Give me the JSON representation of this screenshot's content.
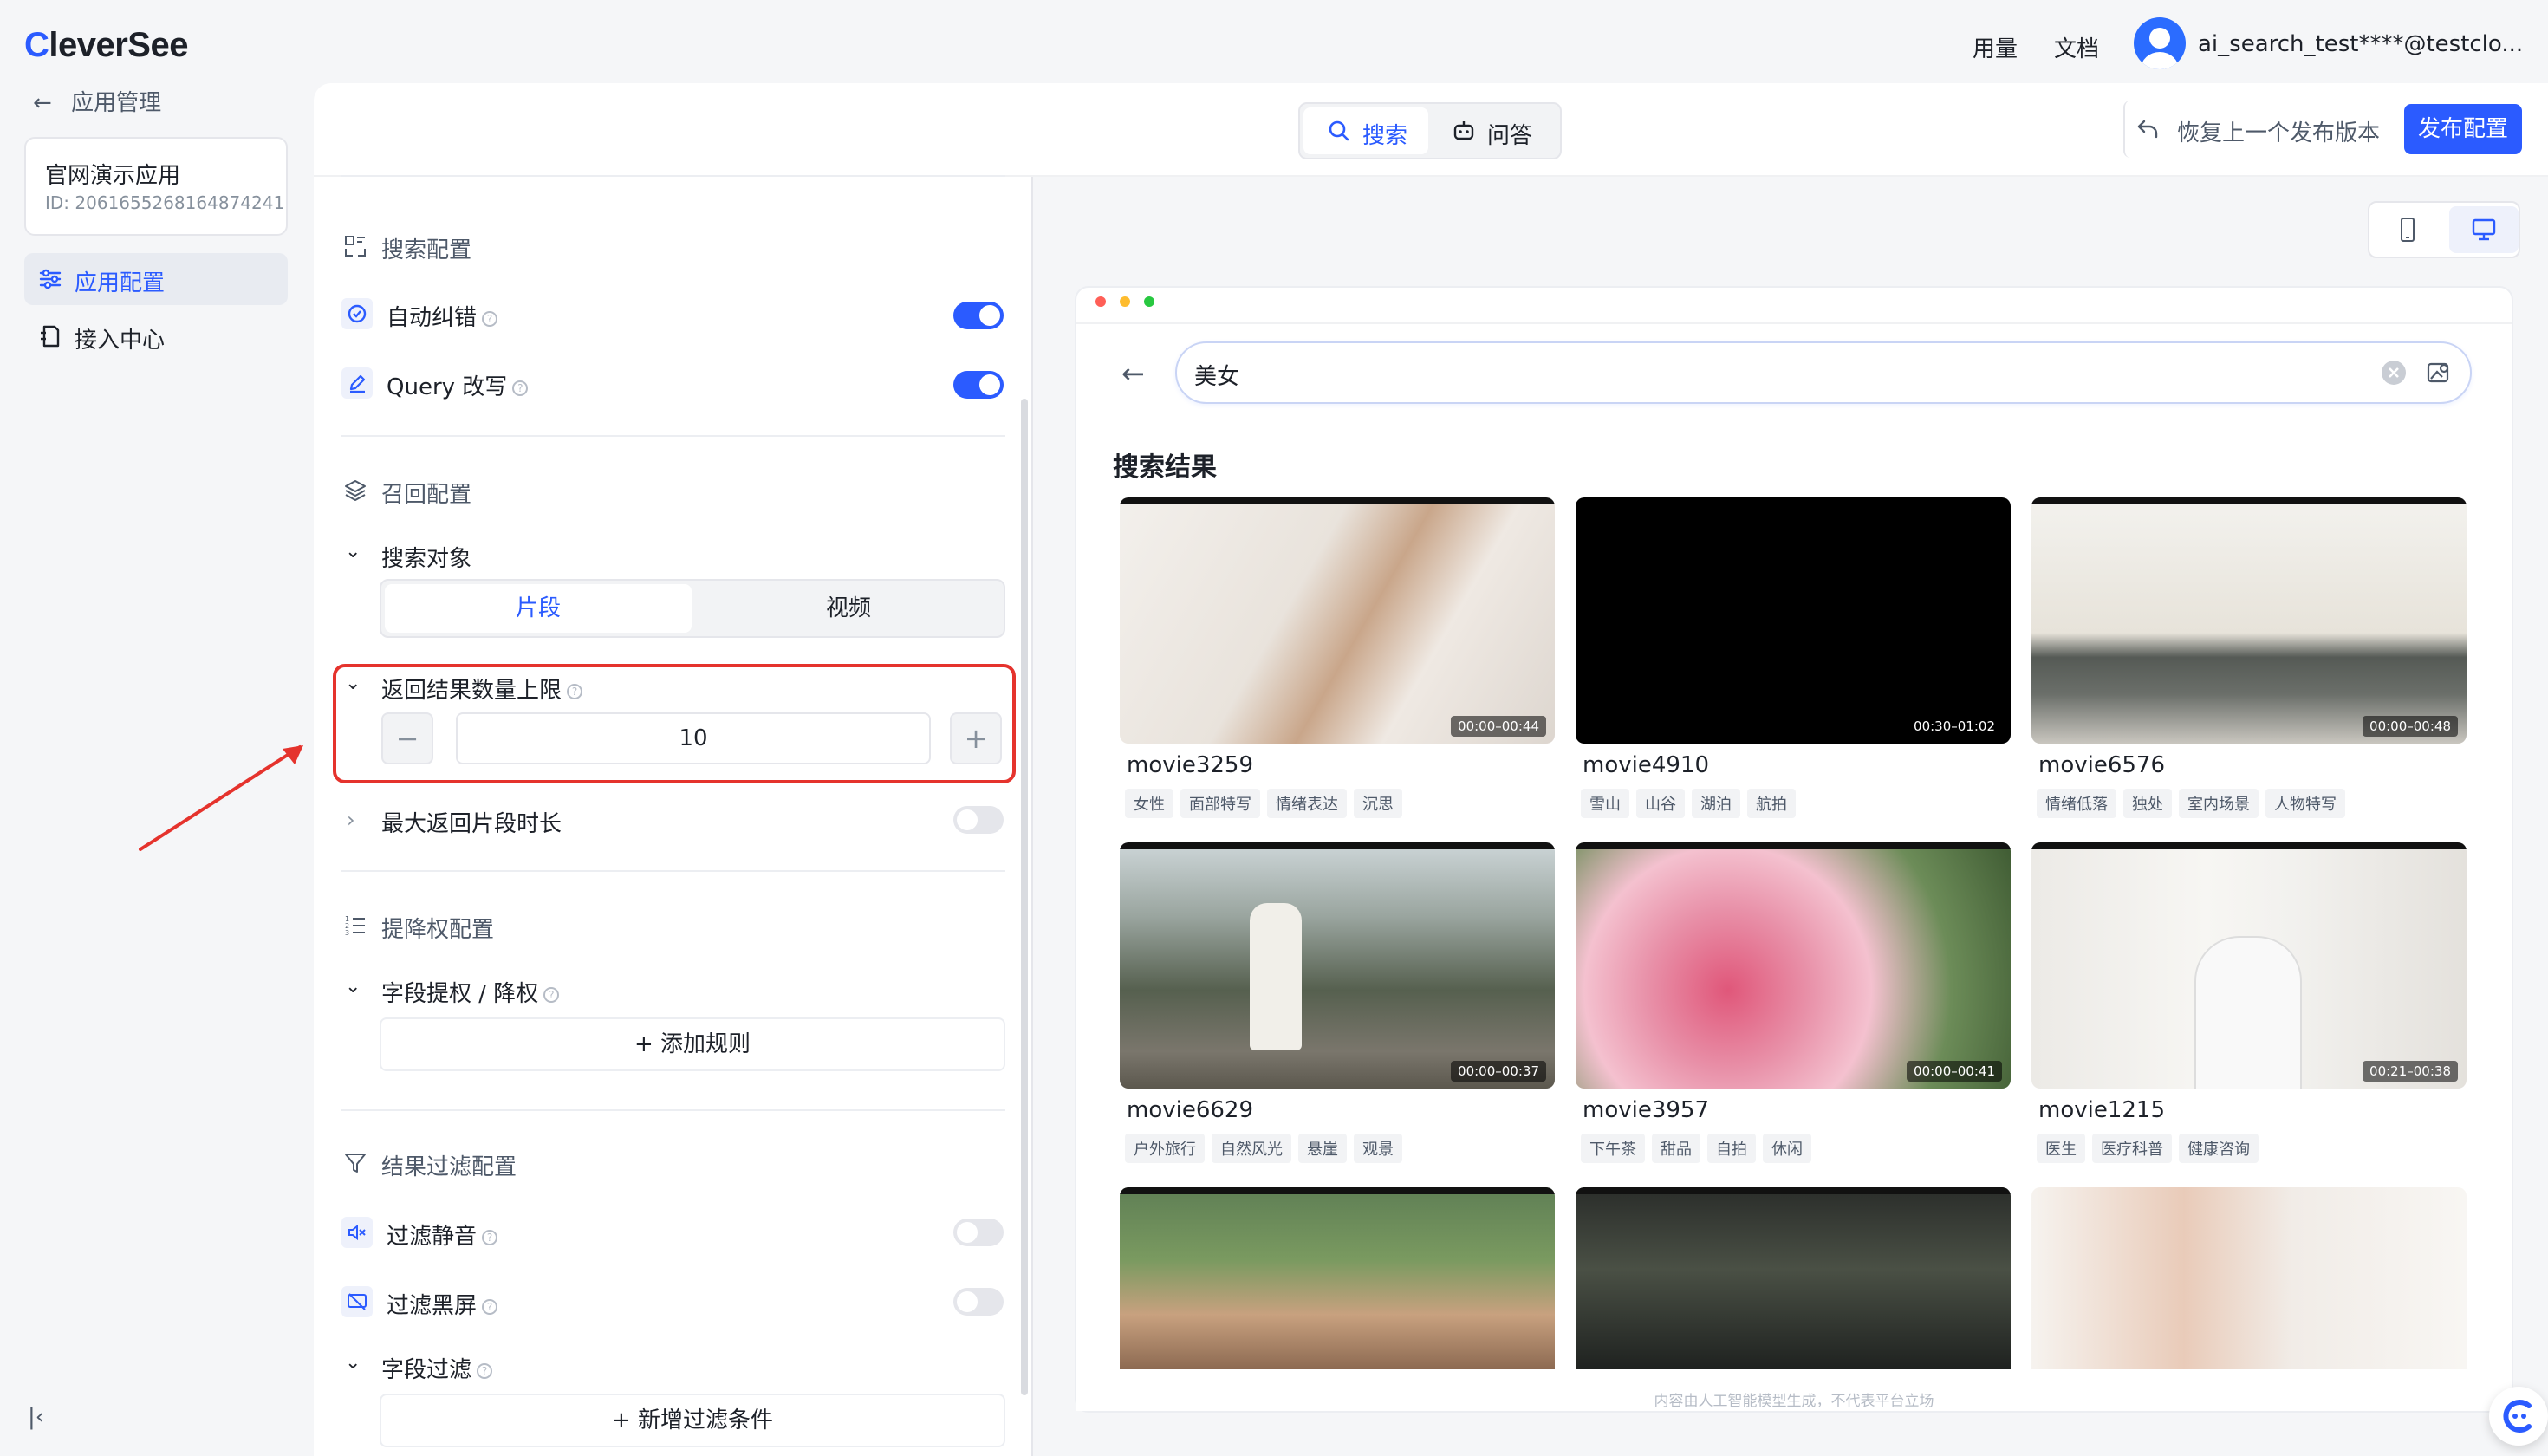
{
  "header": {
    "logo_first": "C",
    "logo_rest": "leverSee",
    "usage": "用量",
    "docs": "文档",
    "user_email": "ai_search_test****@testclo..."
  },
  "sidebar": {
    "back_label": "应用管理",
    "app_name": "官网演示应用",
    "app_id": "ID: 2061655268164874241",
    "items": [
      {
        "label": "应用配置",
        "active": true
      },
      {
        "label": "接入中心",
        "active": false
      }
    ]
  },
  "toolbar": {
    "tab_search": "搜索",
    "tab_qa": "问答",
    "restore_label": "恢复上一个发布版本",
    "publish_label": "发布配置"
  },
  "config": {
    "search_section": "搜索配置",
    "auto_correct": {
      "label": "自动纠错",
      "on": true
    },
    "query_rewrite": {
      "label": "Query 改写",
      "on": true
    },
    "recall_section": "召回配置",
    "search_target": {
      "label": "搜索对象",
      "options": [
        "片段",
        "视频"
      ],
      "selected": "片段"
    },
    "max_results": {
      "label": "返回结果数量上限",
      "value": "10"
    },
    "max_clip_duration": {
      "label": "最大返回片段时长",
      "on": false
    },
    "boost_section": "提降权配置",
    "field_boost": {
      "label": "字段提权 / 降权",
      "add_label": "添加规则"
    },
    "filter_section": "结果过滤配置",
    "filter_silent": {
      "label": "过滤静音",
      "on": false
    },
    "filter_black": {
      "label": "过滤黑屏",
      "on": false
    },
    "field_filter": {
      "label": "字段过滤",
      "add_label": "新增过滤条件"
    }
  },
  "preview": {
    "search_query": "美女",
    "results_title": "搜索结果",
    "disclaimer": "内容由人工智能模型生成，不代表平台立场",
    "cards": [
      {
        "title": "movie3259",
        "time": "00:00–00:44",
        "tags": [
          "女性",
          "面部特写",
          "情绪表达",
          "沉思"
        ]
      },
      {
        "title": "movie4910",
        "time": "00:30–01:02",
        "tags": [
          "雪山",
          "山谷",
          "湖泊",
          "航拍"
        ]
      },
      {
        "title": "movie6576",
        "time": "00:00–00:48",
        "tags": [
          "情绪低落",
          "独处",
          "室内场景",
          "人物特写"
        ]
      },
      {
        "title": "movie6629",
        "time": "00:00–00:37",
        "tags": [
          "户外旅行",
          "自然风光",
          "悬崖",
          "观景"
        ]
      },
      {
        "title": "movie3957",
        "time": "00:00–00:41",
        "tags": [
          "下午茶",
          "甜品",
          "自拍",
          "休闲"
        ]
      },
      {
        "title": "movie1215",
        "time": "00:21–00:38",
        "tags": [
          "医生",
          "医疗科普",
          "健康咨询"
        ]
      }
    ]
  }
}
